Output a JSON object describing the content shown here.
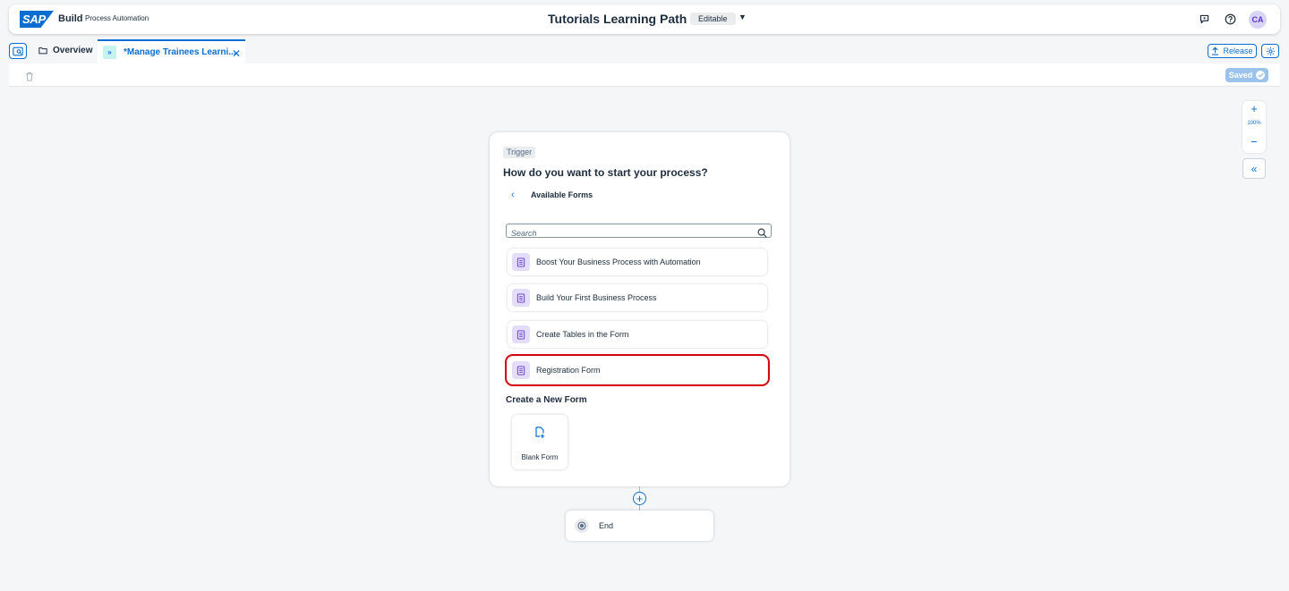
{
  "shell": {
    "logo_text": "SAP",
    "product": "Build",
    "product_sub": "Process Automation",
    "project_title": "Tutorials Learning Path",
    "status_badge": "Editable",
    "user_initials": "CA",
    "icons": [
      "feedback-icon",
      "help-icon"
    ]
  },
  "tabs": {
    "overview_label": "Overview",
    "active_label": "*Manage Trainees Learni...",
    "release_label": "Release"
  },
  "toolbar": {
    "saved_label": "Saved"
  },
  "canvas": {
    "zoom_level": "100%"
  },
  "trigger_card": {
    "badge": "Trigger",
    "heading": "How do you want to start your process?",
    "back_label": "Available Forms",
    "search_placeholder": "Search",
    "forms": [
      {
        "label": "Boost Your Business Process with Automation"
      },
      {
        "label": "Build Your First Business Process"
      },
      {
        "label": "Create Tables in the Form"
      },
      {
        "label": "Registration Form"
      }
    ],
    "highlighted_form": "Registration Form",
    "new_form_heading": "Create a New Form",
    "blank_form_label": "Blank Form"
  },
  "end_node": {
    "label": "End"
  },
  "colors": {
    "accent": "#0a6ed1",
    "highlight": "#d9050e",
    "form_icon_bg": "#e4dcfb"
  }
}
